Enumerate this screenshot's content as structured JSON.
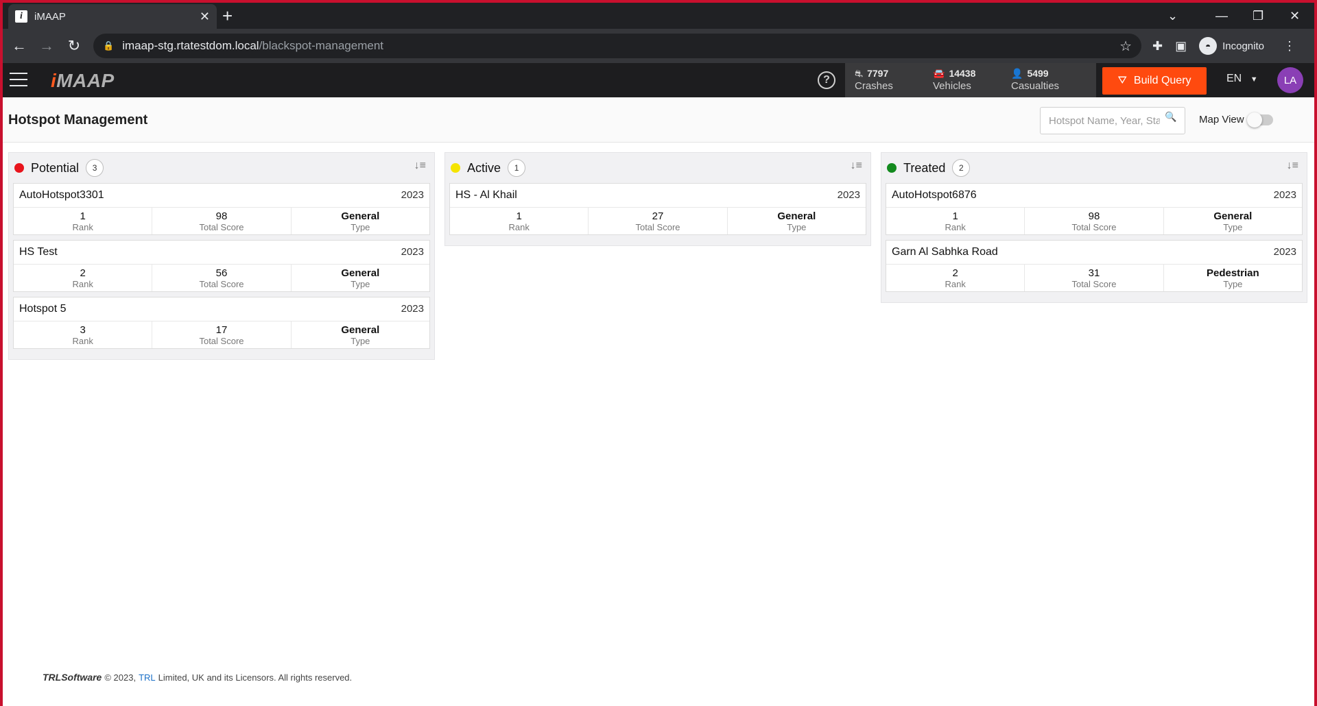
{
  "browser": {
    "tab_title": "iMAAP",
    "url_host": "imaap-stg.rtatestdom.local",
    "url_path": "/blackspot-management",
    "profile_label": "Incognito"
  },
  "header": {
    "logo": "iMAAP",
    "stats": [
      {
        "value": "7797",
        "label": "Crashes"
      },
      {
        "value": "14438",
        "label": "Vehicles"
      },
      {
        "value": "5499",
        "label": "Casualties"
      }
    ],
    "build_query_label": "Build Query",
    "language": "EN",
    "avatar_initials": "LA"
  },
  "page": {
    "title": "Hotspot Management",
    "search_placeholder": "Hotspot Name, Year, Sta",
    "map_view_label": "Map View"
  },
  "columns": [
    {
      "title": "Potential",
      "count": "3",
      "color": "#e8141c",
      "cards": [
        {
          "name": "AutoHotspot3301",
          "year": "2023",
          "rank": "1",
          "score": "98",
          "type": "General"
        },
        {
          "name": "HS Test",
          "year": "2023",
          "rank": "2",
          "score": "56",
          "type": "General"
        },
        {
          "name": "Hotspot 5",
          "year": "2023",
          "rank": "3",
          "score": "17",
          "type": "General"
        }
      ]
    },
    {
      "title": "Active",
      "count": "1",
      "color": "#f5e400",
      "cards": [
        {
          "name": "HS - Al Khail",
          "year": "2023",
          "rank": "1",
          "score": "27",
          "type": "General"
        }
      ]
    },
    {
      "title": "Treated",
      "count": "2",
      "color": "#138a1e",
      "cards": [
        {
          "name": "AutoHotspot6876",
          "year": "2023",
          "rank": "1",
          "score": "98",
          "type": "General"
        },
        {
          "name": "Garn Al Sabhka Road",
          "year": "2023",
          "rank": "2",
          "score": "31",
          "type": "Pedestrian"
        }
      ]
    }
  ],
  "metric_labels": {
    "rank": "Rank",
    "score": "Total Score",
    "type": "Type"
  },
  "footer": {
    "brand": "TRLSoftware",
    "copyright": "© 2023,",
    "link": "TRL",
    "rest": "Limited, UK and its Licensors. All rights reserved."
  }
}
